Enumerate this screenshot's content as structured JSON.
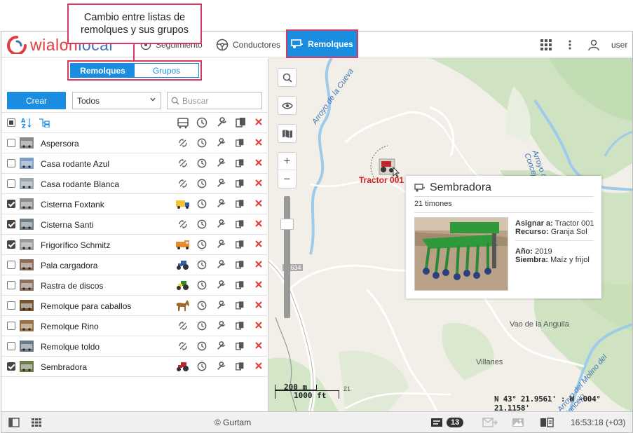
{
  "callout": {
    "text": "Cambio entre listas de remolques y sus grupos"
  },
  "header": {
    "logo_main": "wialon",
    "logo_light": "local",
    "nav": {
      "seguimiento": "Seguimiento",
      "conductores": "Conductores",
      "remolques": "Remolques"
    },
    "user": "user"
  },
  "panel": {
    "toggle": {
      "remolques": "Remolques",
      "grupos": "Grupos"
    },
    "create_label": "Crear",
    "filter_value": "Todos",
    "search_placeholder": "Buscar",
    "rows": [
      {
        "name": "Aspersora",
        "checked": false,
        "unit": "none"
      },
      {
        "name": "Casa rodante Azul",
        "checked": false,
        "unit": "none"
      },
      {
        "name": "Casa rodante Blanca",
        "checked": false,
        "unit": "none"
      },
      {
        "name": "Cisterna Foxtank",
        "checked": true,
        "unit": "truck-yellow"
      },
      {
        "name": "Cisterna Santi",
        "checked": true,
        "unit": "none"
      },
      {
        "name": "Frigorífico Schmitz",
        "checked": true,
        "unit": "truck-orange"
      },
      {
        "name": "Pala cargadora",
        "checked": false,
        "unit": "tractor-blue"
      },
      {
        "name": "Rastra de discos",
        "checked": false,
        "unit": "tractor-green"
      },
      {
        "name": "Remolque para caballos",
        "checked": false,
        "unit": "horse"
      },
      {
        "name": "Remolque Rino",
        "checked": false,
        "unit": "none"
      },
      {
        "name": "Remolque toldo",
        "checked": false,
        "unit": "none"
      },
      {
        "name": "Sembradora",
        "checked": true,
        "unit": "tractor-red"
      }
    ]
  },
  "map": {
    "unit_label": "Tractor 001",
    "popup": {
      "title": "Sembradora",
      "subtitle": "21 timones",
      "assign_label": "Asignar a:",
      "assign_value": "Tractor 001",
      "resource_label": "Recurso:",
      "resource_value": "Granja Sol",
      "year_label": "Año:",
      "year_value": "2019",
      "sowing_label": "Siembra:",
      "sowing_value": "Maíz y frijol"
    },
    "places": {
      "vao": "Vao de la Anguila",
      "villanes": "Villanes",
      "road": "N-634",
      "arroyo_cueva": "Arroyo de la Cueva",
      "arroyo_molino": "Arroyo del Molino del Concejo",
      "arroyo_molino2": "Arroyo del Molino del Concejo",
      "road_num": "21"
    },
    "scale_m": "200 m",
    "scale_ft": "1000 ft",
    "coords": "N 43° 21.9561' : W -004° 21.1158'"
  },
  "footer": {
    "copyright": "© Gurtam",
    "messages_count": "13",
    "time": "16:53:18 (+03)"
  },
  "colors": {
    "accent": "#1a8de0",
    "highlight": "#d63a63",
    "delete": "#e53935"
  }
}
